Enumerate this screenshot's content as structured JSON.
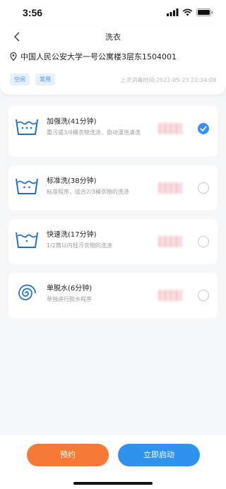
{
  "status_bar": {
    "time": "3:56"
  },
  "header": {
    "title": "洗衣"
  },
  "location": {
    "address": "中国人民公安大学一号公寓楼3层东1504001"
  },
  "tags": [
    "空闲",
    "常用"
  ],
  "last_cleaned": "上次消毒时间:2021-05-23 22:34:09",
  "programs": [
    {
      "title": "加强洗(41分钟)",
      "desc": "重污或3/4桶衣物洗涤，自动漫泡清洗",
      "price": "",
      "icon": "wash-intensive-icon",
      "selected": true
    },
    {
      "title": "标准洗(38分钟)",
      "desc": "标准程序，适合2/3桶衣物的洗涤",
      "price": "",
      "icon": "wash-standard-icon",
      "selected": false
    },
    {
      "title": "快速洗(17分钟)",
      "desc": "1/2筒以内轻污衣物的洗涤",
      "price": "",
      "icon": "wash-quick-icon",
      "selected": false
    },
    {
      "title": "单脱水(6分钟)",
      "desc": "单独进行脱水程序",
      "price": "",
      "icon": "spin-icon",
      "selected": false
    }
  ],
  "actions": {
    "book": "预约",
    "start": "立即启动"
  },
  "colors": {
    "accent_blue": "#2f93ee",
    "accent_orange": "#f57a35",
    "icon_blue": "#1f6fc4"
  }
}
